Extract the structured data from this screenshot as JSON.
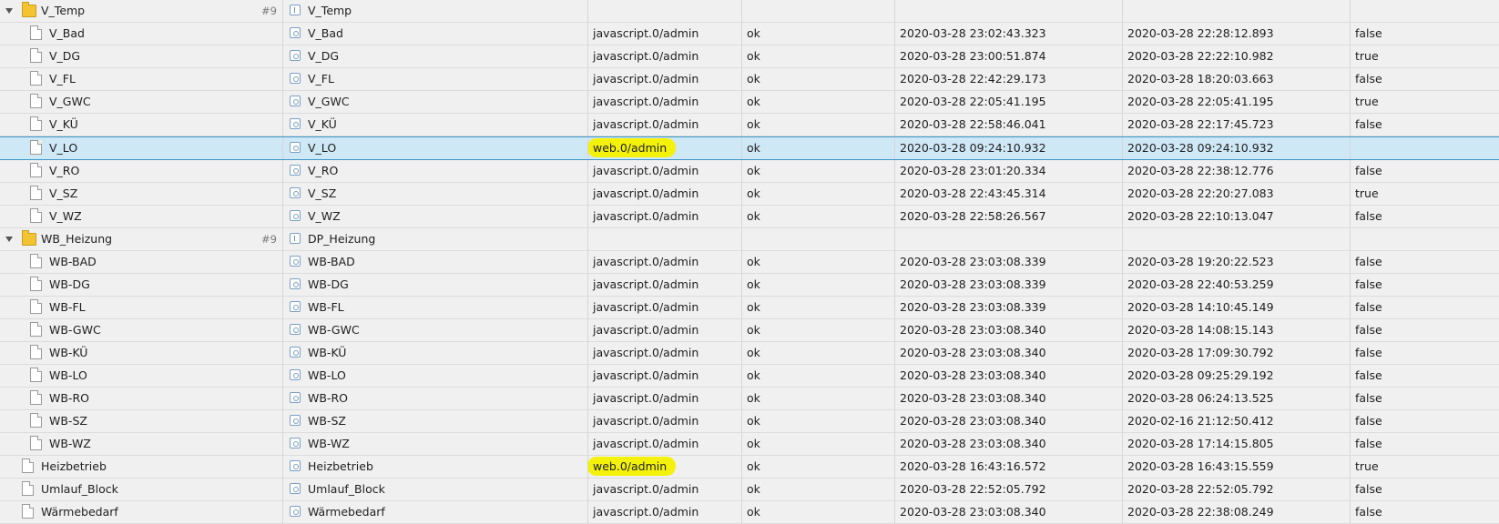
{
  "rows": [
    {
      "type": "folder",
      "name": "V_Temp",
      "count": "#9",
      "role": "V_Temp",
      "role_icon": "info-icon",
      "from": "",
      "status": "",
      "ts": "",
      "lc": "",
      "val": ""
    },
    {
      "type": "child",
      "name": "V_Bad",
      "role": "V_Bad",
      "from": "javascript.0/admin",
      "status": "ok",
      "ts": "2020-03-28 23:02:43.323",
      "lc": "2020-03-28 22:28:12.893",
      "val": "false"
    },
    {
      "type": "child",
      "name": "V_DG",
      "role": "V_DG",
      "from": "javascript.0/admin",
      "status": "ok",
      "ts": "2020-03-28 23:00:51.874",
      "lc": "2020-03-28 22:22:10.982",
      "val": "true"
    },
    {
      "type": "child",
      "name": "V_FL",
      "role": "V_FL",
      "from": "javascript.0/admin",
      "status": "ok",
      "ts": "2020-03-28 22:42:29.173",
      "lc": "2020-03-28 18:20:03.663",
      "val": "false"
    },
    {
      "type": "child",
      "name": "V_GWC",
      "role": "V_GWC",
      "from": "javascript.0/admin",
      "status": "ok",
      "ts": "2020-03-28 22:05:41.195",
      "lc": "2020-03-28 22:05:41.195",
      "val": "true"
    },
    {
      "type": "child",
      "name": "V_KÜ",
      "role": "V_KÜ",
      "from": "javascript.0/admin",
      "status": "ok",
      "ts": "2020-03-28 22:58:46.041",
      "lc": "2020-03-28 22:17:45.723",
      "val": "false"
    },
    {
      "type": "child",
      "selected": true,
      "highlight": true,
      "name": "V_LO",
      "role": "V_LO",
      "from": "web.0/admin",
      "status": "ok",
      "ts": "2020-03-28 09:24:10.932",
      "lc": "2020-03-28 09:24:10.932",
      "val": ""
    },
    {
      "type": "child",
      "name": "V_RO",
      "role": "V_RO",
      "from": "javascript.0/admin",
      "status": "ok",
      "ts": "2020-03-28 23:01:20.334",
      "lc": "2020-03-28 22:38:12.776",
      "val": "false"
    },
    {
      "type": "child",
      "name": "V_SZ",
      "role": "V_SZ",
      "from": "javascript.0/admin",
      "status": "ok",
      "ts": "2020-03-28 22:43:45.314",
      "lc": "2020-03-28 22:20:27.083",
      "val": "true"
    },
    {
      "type": "child",
      "name": "V_WZ",
      "role": "V_WZ",
      "from": "javascript.0/admin",
      "status": "ok",
      "ts": "2020-03-28 22:58:26.567",
      "lc": "2020-03-28 22:10:13.047",
      "val": "false"
    },
    {
      "type": "folder",
      "name": "WB_Heizung",
      "count": "#9",
      "role": "DP_Heizung",
      "role_icon": "info-icon",
      "from": "",
      "status": "",
      "ts": "",
      "lc": "",
      "val": ""
    },
    {
      "type": "child",
      "name": "WB-BAD",
      "role": "WB-BAD",
      "from": "javascript.0/admin",
      "status": "ok",
      "ts": "2020-03-28 23:03:08.339",
      "lc": "2020-03-28 19:20:22.523",
      "val": "false"
    },
    {
      "type": "child",
      "name": "WB-DG",
      "role": "WB-DG",
      "from": "javascript.0/admin",
      "status": "ok",
      "ts": "2020-03-28 23:03:08.339",
      "lc": "2020-03-28 22:40:53.259",
      "val": "false"
    },
    {
      "type": "child",
      "name": "WB-FL",
      "role": "WB-FL",
      "from": "javascript.0/admin",
      "status": "ok",
      "ts": "2020-03-28 23:03:08.339",
      "lc": "2020-03-28 14:10:45.149",
      "val": "false"
    },
    {
      "type": "child",
      "name": "WB-GWC",
      "role": "WB-GWC",
      "from": "javascript.0/admin",
      "status": "ok",
      "ts": "2020-03-28 23:03:08.340",
      "lc": "2020-03-28 14:08:15.143",
      "val": "false"
    },
    {
      "type": "child",
      "name": "WB-KÜ",
      "role": "WB-KÜ",
      "from": "javascript.0/admin",
      "status": "ok",
      "ts": "2020-03-28 23:03:08.340",
      "lc": "2020-03-28 17:09:30.792",
      "val": "false"
    },
    {
      "type": "child",
      "name": "WB-LO",
      "role": "WB-LO",
      "from": "javascript.0/admin",
      "status": "ok",
      "ts": "2020-03-28 23:03:08.340",
      "lc": "2020-03-28 09:25:29.192",
      "val": "false"
    },
    {
      "type": "child",
      "name": "WB-RO",
      "role": "WB-RO",
      "from": "javascript.0/admin",
      "status": "ok",
      "ts": "2020-03-28 23:03:08.340",
      "lc": "2020-03-28 06:24:13.525",
      "val": "false"
    },
    {
      "type": "child",
      "name": "WB-SZ",
      "role": "WB-SZ",
      "from": "javascript.0/admin",
      "status": "ok",
      "ts": "2020-03-28 23:03:08.340",
      "lc": "2020-02-16 21:12:50.412",
      "val": "false"
    },
    {
      "type": "child",
      "name": "WB-WZ",
      "role": "WB-WZ",
      "from": "javascript.0/admin",
      "status": "ok",
      "ts": "2020-03-28 23:03:08.340",
      "lc": "2020-03-28 17:14:15.805",
      "val": "false"
    },
    {
      "type": "top",
      "highlight": true,
      "name": "Heizbetrieb",
      "role": "Heizbetrieb",
      "from": "web.0/admin",
      "status": "ok",
      "ts": "2020-03-28 16:43:16.572",
      "lc": "2020-03-28 16:43:15.559",
      "val": "true"
    },
    {
      "type": "top",
      "name": "Umlauf_Block",
      "role": "Umlauf_Block",
      "from": "javascript.0/admin",
      "status": "ok",
      "ts": "2020-03-28 22:52:05.792",
      "lc": "2020-03-28 22:52:05.792",
      "val": "false"
    },
    {
      "type": "top",
      "name": "Wärmebedarf",
      "role": "Wärmebedarf",
      "from": "javascript.0/admin",
      "status": "ok",
      "ts": "2020-03-28 23:03:08.340",
      "lc": "2020-03-28 22:38:08.249",
      "val": "false"
    }
  ],
  "colors": {
    "highlight": "#f4f20a",
    "selected_bg": "#cfe8f5",
    "selected_border": "#3a97c9",
    "folder": "#f3c431"
  }
}
